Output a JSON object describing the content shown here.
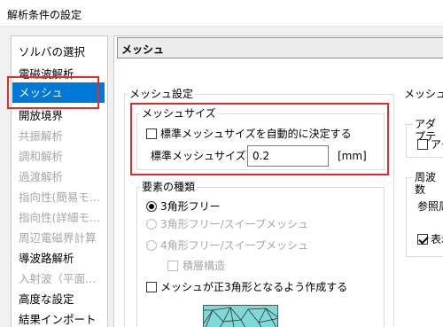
{
  "window": {
    "title": "解析条件の設定"
  },
  "sidebar": {
    "items": [
      {
        "label": "ソルバの選択",
        "state": "normal"
      },
      {
        "label": "電磁波解析",
        "state": "normal"
      },
      {
        "label": "メッシュ",
        "state": "selected"
      },
      {
        "label": "開放境界",
        "state": "normal"
      },
      {
        "label": "共振解析",
        "state": "disabled"
      },
      {
        "label": "調和解析",
        "state": "disabled"
      },
      {
        "label": "過渡解析",
        "state": "disabled"
      },
      {
        "label": "指向性(簡易モ…",
        "state": "disabled"
      },
      {
        "label": "指向性(詳細モ…",
        "state": "disabled"
      },
      {
        "label": "周辺電磁界計算",
        "state": "disabled"
      },
      {
        "label": "導波路解析",
        "state": "normal"
      },
      {
        "label": "入射波（平面…",
        "state": "disabled"
      },
      {
        "label": "高度な設定",
        "state": "normal"
      },
      {
        "label": "結果インポート",
        "state": "normal"
      }
    ]
  },
  "panel": {
    "header": "メッシュ",
    "mesh_settings": {
      "label": "メッシュ設定",
      "mesh_size": {
        "label": "メッシュサイズ",
        "auto_label": "標準メッシュサイズを自動的に決定する",
        "auto_checked": false,
        "standard_label": "標準メッシュサイズ",
        "standard_value": "0.2",
        "unit": "[mm]"
      },
      "element_type": {
        "label": "要素の種類",
        "options": [
          {
            "label": "3角形フリー",
            "checked": true,
            "disabled": false
          },
          {
            "label": "3角形フリー/スイープメッシュ",
            "checked": false,
            "disabled": true
          },
          {
            "label": "4角形フリー/スイープメッシュ",
            "checked": false,
            "disabled": true
          }
        ],
        "layered_label": "積層構造",
        "regular_triangle_label": "メッシュが正3角形となるよう作成する"
      }
    },
    "right_clipped": {
      "mesh_label": "メッシュ",
      "adaptive_label": "アダプテ",
      "adaptive_check": "アダ",
      "frequency_label": "周波数",
      "reference_label": "参照周",
      "display_label": "表示"
    }
  },
  "colors": {
    "selection": "#0078d7",
    "highlight": "#e22c2c",
    "mesh_preview": "#7fd9d6"
  }
}
